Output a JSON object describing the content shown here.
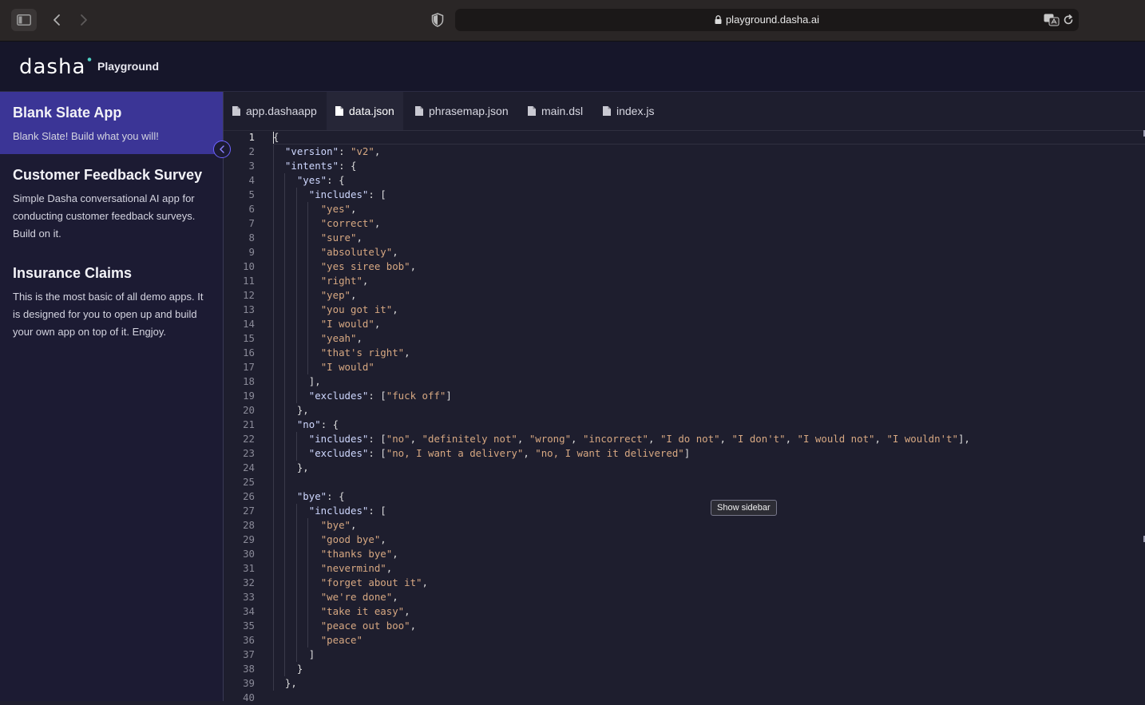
{
  "browser": {
    "url": "playground.dasha.ai",
    "icons": [
      "sidebar-toggle-icon",
      "back-arrow-icon",
      "forward-arrow-icon",
      "shield-icon",
      "lock-icon",
      "translate-icon",
      "reload-icon"
    ]
  },
  "header": {
    "logo_text": "dasha",
    "product": "Playground"
  },
  "sidebar": {
    "apps": [
      {
        "title": "Blank Slate App",
        "description": "Blank Slate! Build what you will!"
      },
      {
        "title": "Customer Feedback Survey",
        "description": "Simple Dasha conversational AI app for conducting customer feedback surveys. Build on it."
      },
      {
        "title": "Insurance Claims",
        "description": "This is the most basic of all demo apps. It is designed for you to open up and build your own app on top of it. Engjoy."
      }
    ]
  },
  "tabs": [
    {
      "label": "app.dashaapp"
    },
    {
      "label": "data.json"
    },
    {
      "label": "phrasemap.json"
    },
    {
      "label": "main.dsl"
    },
    {
      "label": "index.js"
    }
  ],
  "tooltip": "Show sidebar",
  "colors": {
    "accent": "#3b3596",
    "accent_border": "#6e63ff",
    "sidebar_bg": "#1c1b33",
    "editor_bg": "#1e1e2e",
    "string": "#d7a882",
    "key": "#cfd8ff"
  },
  "code_lines": [
    "{",
    "  \"version\": \"v2\",",
    "  \"intents\": {",
    "    \"yes\": {",
    "      \"includes\": [",
    "        \"yes\",",
    "        \"correct\",",
    "        \"sure\",",
    "        \"absolutely\",",
    "        \"yes siree bob\",",
    "        \"right\",",
    "        \"yep\",",
    "        \"you got it\",",
    "        \"I would\",",
    "        \"yeah\",",
    "        \"that's right\",",
    "        \"I would\"",
    "      ],",
    "      \"excludes\": [\"fuck off\"]",
    "    },",
    "    \"no\": {",
    "      \"includes\": [\"no\", \"definitely not\", \"wrong\", \"incorrect\", \"I do not\", \"I don't\", \"I would not\", \"I wouldn't\"],",
    "      \"excludes\": [\"no, I want a delivery\", \"no, I want it delivered\"]",
    "    },",
    "",
    "    \"bye\": {",
    "      \"includes\": [",
    "        \"bye\",",
    "        \"good bye\",",
    "        \"thanks bye\",",
    "        \"nevermind\",",
    "        \"forget about it\",",
    "        \"we're done\",",
    "        \"take it easy\",",
    "        \"peace out boo\",",
    "        \"peace\"",
    "      ]",
    "    }",
    "  },",
    ""
  ]
}
